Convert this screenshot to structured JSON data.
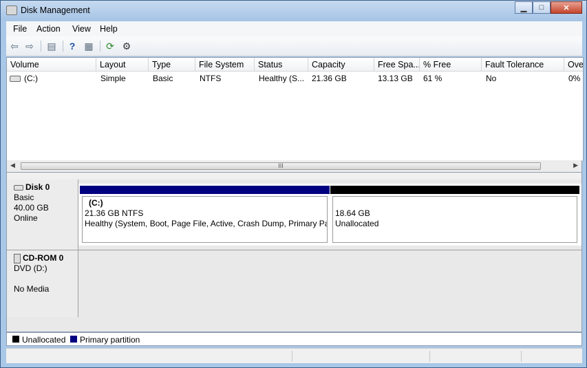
{
  "window": {
    "title": "Disk Management"
  },
  "menu": [
    "File",
    "Action",
    "View",
    "Help"
  ],
  "toolbar_icons": [
    "back-icon",
    "forward-icon",
    "show-hide-console-tree-icon",
    "help-icon",
    "properties-icon",
    "refresh-icon",
    "settings-icon"
  ],
  "columns": [
    "Volume",
    "Layout",
    "Type",
    "File System",
    "Status",
    "Capacity",
    "Free Spa...",
    "% Free",
    "Fault Tolerance",
    "Ove"
  ],
  "volumes": [
    {
      "volume": "(C:)",
      "layout": "Simple",
      "type": "Basic",
      "fs": "NTFS",
      "status": "Healthy (S...",
      "capacity": "21.36 GB",
      "free": "13.13 GB",
      "pct_free": "61 %",
      "fault": "No",
      "overhead": "0%"
    }
  ],
  "scroll_grip": "III",
  "disks": [
    {
      "name": "Disk 0",
      "type": "Basic",
      "size": "40.00 GB",
      "state": "Online",
      "partitions": [
        {
          "label": "(C:)",
          "size": "21.36 GB NTFS",
          "status": "Healthy (System, Boot, Page File, Active, Crash Dump, Primary Par",
          "bar_color": "#000080"
        },
        {
          "label": "",
          "size": "18.64 GB",
          "status": "Unallocated",
          "bar_color": "#000000"
        }
      ]
    },
    {
      "name": "CD-ROM 0",
      "type": "DVD (D:)",
      "state": "No Media"
    }
  ],
  "legend": [
    {
      "label": "Unallocated",
      "color": "#000000"
    },
    {
      "label": "Primary partition",
      "color": "#000080"
    }
  ]
}
